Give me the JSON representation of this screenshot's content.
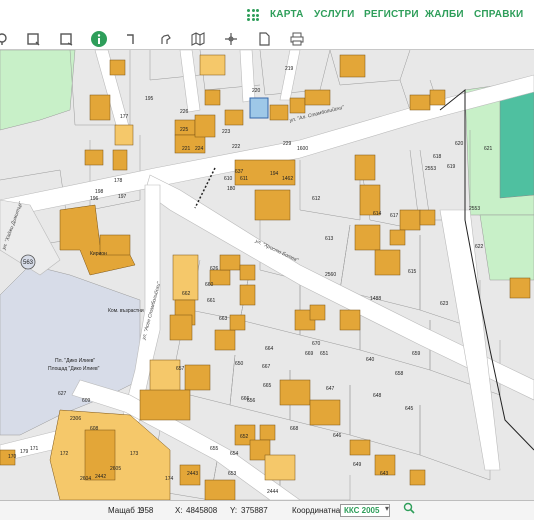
{
  "nav": {
    "items": [
      "КАРТА",
      "УСЛУГИ",
      "РЕГИСТРИ",
      "ЖАЛБИ",
      "СПРАВКИ"
    ]
  },
  "toolbar": {
    "tools": [
      "pin-icon",
      "select-rect-icon",
      "select-rect2-icon",
      "info-icon",
      "measure-icon",
      "pan-icon",
      "map-icon",
      "crosshair-icon",
      "document-icon",
      "print-icon"
    ],
    "active_tool": "info-icon",
    "accent_color": "#2e9e5a"
  },
  "map": {
    "streets": [
      "ул. \"Ал. Стамболийски\"",
      "ул. \"Христо Ботев\"",
      "ул. \"Хаджи Димитър\"",
      "ул. \"Асен Стамболийски\""
    ],
    "labels": {
      "circle_badge": "563",
      "place": "Площад \"Дико Илиев\"",
      "place_sub": "Пл. \"Дико Илиев\"",
      "church": "Ком. възрастни",
      "building_label": "Кирион"
    },
    "parcel_numbers": [
      "226",
      "220",
      "219",
      "221",
      "222",
      "223",
      "224",
      "225",
      "229",
      "1462",
      "1600",
      "612",
      "613",
      "614",
      "615",
      "617",
      "618",
      "619",
      "620",
      "621",
      "622",
      "623",
      "2553",
      "2553",
      "1488",
      "2560",
      "660",
      "661",
      "662",
      "663",
      "664",
      "665",
      "666",
      "667",
      "668",
      "669",
      "670",
      "651",
      "652",
      "653",
      "654",
      "655",
      "656",
      "657",
      "658",
      "659",
      "640",
      "643",
      "645",
      "646",
      "647",
      "648",
      "649",
      "650",
      "637",
      "610",
      "2442",
      "2443",
      "2444",
      "2604",
      "2605",
      "2306",
      "626",
      "627",
      "608",
      "609",
      "611",
      "180",
      "194",
      "195",
      "196",
      "197",
      "198",
      "178",
      "177",
      "170",
      "179",
      "171",
      "172",
      "173",
      "174"
    ],
    "colors": {
      "parcel_fill": "#e8e8e8",
      "building_fill": "#e3a638",
      "building_fill_light": "#f5c86a",
      "road_fill": "#ffffff",
      "green_fill": "#c8f0c8",
      "pitch_fill": "#4fc0a0",
      "square_fill": "#d7dce8",
      "boundary": "#333333"
    }
  },
  "status": {
    "scale_label": "Мащаб 1:",
    "scale_value": "958",
    "x_label": "X:",
    "x_value": "4845808",
    "y_label": "Y:",
    "y_value": "375887",
    "crs_label": "Координатна система:",
    "crs_value": "ККС 2005"
  }
}
